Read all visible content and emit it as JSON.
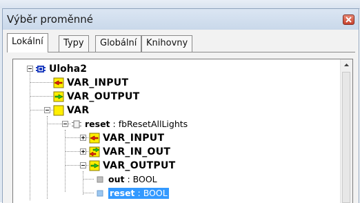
{
  "window": {
    "title": "Výběr proměnné"
  },
  "tabs": [
    {
      "label": "Lokální",
      "active": true
    },
    {
      "label": "Typy",
      "active": false
    },
    {
      "label": "Globální",
      "active": false
    },
    {
      "label": "Knihovny",
      "active": false
    }
  ],
  "tree": {
    "root": "Uloha2",
    "var_input": "VAR_INPUT",
    "var_output": "VAR_OUTPUT",
    "var": "VAR",
    "reset_name": "reset",
    "reset_type": " : fbResetAllLights",
    "child_var_input": "VAR_INPUT",
    "child_var_in_out": "VAR_IN_OUT",
    "child_var_output": "VAR_OUTPUT",
    "out_name": "out",
    "out_type": " : BOOL",
    "sel_name": "reset",
    "sel_type": " : BOOL"
  },
  "colors": {
    "selection": "#3399ff",
    "folder_yellow": "#ffee00",
    "arrow_red": "#e02010",
    "arrow_green": "#22c020"
  },
  "icons": {
    "close": "close-icon",
    "program": "program-icon",
    "var_input": "var-input-icon",
    "var_output": "var-output-icon",
    "var_folder": "var-folder-icon",
    "function_block": "function-block-icon",
    "var_in_out": "var-in-out-icon",
    "bool_var": "bool-variable-icon"
  }
}
